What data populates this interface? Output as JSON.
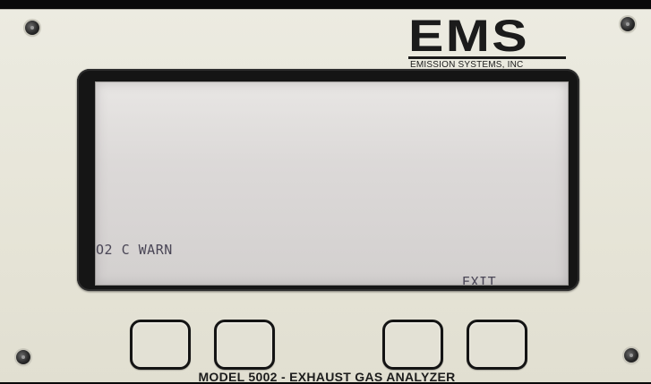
{
  "brand": {
    "logo": "EMS",
    "company": "EMISSION SYSTEMS, INC"
  },
  "display": {
    "message": "O2 C WARN",
    "softkey_label": "EXIT"
  },
  "device": {
    "model_label": "MODEL 5002 - EXHAUST GAS ANALYZER"
  },
  "keys": [
    {
      "name": "soft-key-1",
      "label": ""
    },
    {
      "name": "soft-key-2",
      "label": ""
    },
    {
      "name": "soft-key-3",
      "label": ""
    },
    {
      "name": "soft-key-4",
      "label": ""
    }
  ],
  "icons": [
    "screw-icon"
  ],
  "colors": {
    "panel": "#e6e4d7",
    "lcd_background": "#dcd9d8",
    "lcd_text": "#4a4656",
    "bezel": "#151515"
  }
}
